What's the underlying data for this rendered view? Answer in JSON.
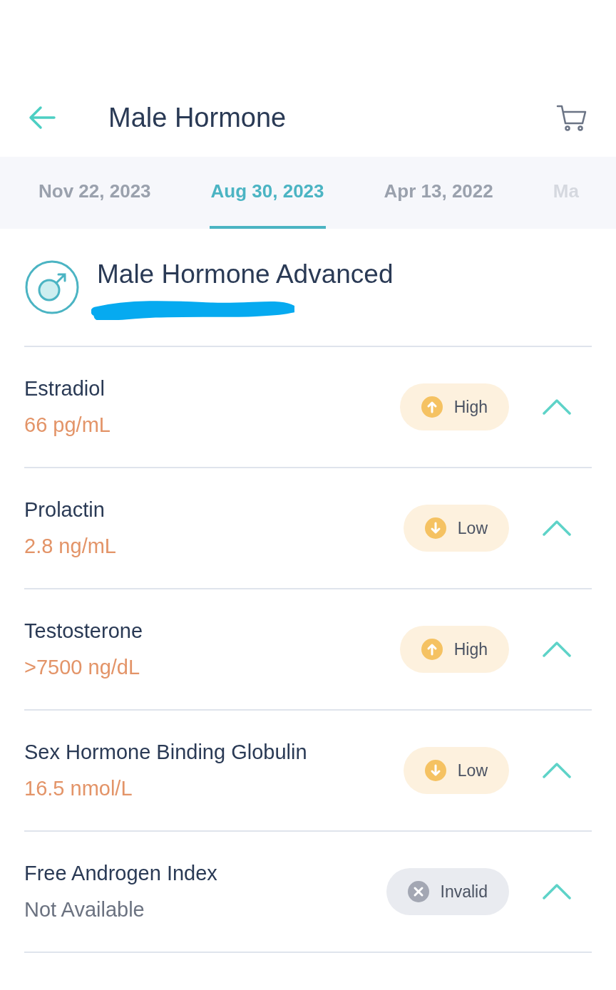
{
  "header": {
    "title": "Male Hormone"
  },
  "tabs": [
    {
      "label": "Nov 22, 2023",
      "selected": false
    },
    {
      "label": "Aug 30, 2023",
      "selected": true
    },
    {
      "label": "Apr 13, 2022",
      "selected": false
    },
    {
      "label": "Ma",
      "selected": false
    }
  ],
  "panel": {
    "title": "Male Hormone Advanced"
  },
  "results": [
    {
      "name": "Estradiol",
      "value": "66 pg/mL",
      "kind": "high",
      "badge": "High",
      "expanded": false
    },
    {
      "name": "Prolactin",
      "value": "2.8 ng/mL",
      "kind": "low",
      "badge": "Low",
      "expanded": false
    },
    {
      "name": "Testosterone",
      "value": ">7500 ng/dL",
      "kind": "high",
      "badge": "High",
      "expanded": false
    },
    {
      "name": "Sex Hormone Binding Globulin",
      "value": "16.5 nmol/L",
      "kind": "low",
      "badge": "Low",
      "expanded": false
    },
    {
      "name": "Free Androgen Index",
      "value": "Not Available",
      "kind": "invalid",
      "badge": "Invalid",
      "expanded": false
    }
  ]
}
